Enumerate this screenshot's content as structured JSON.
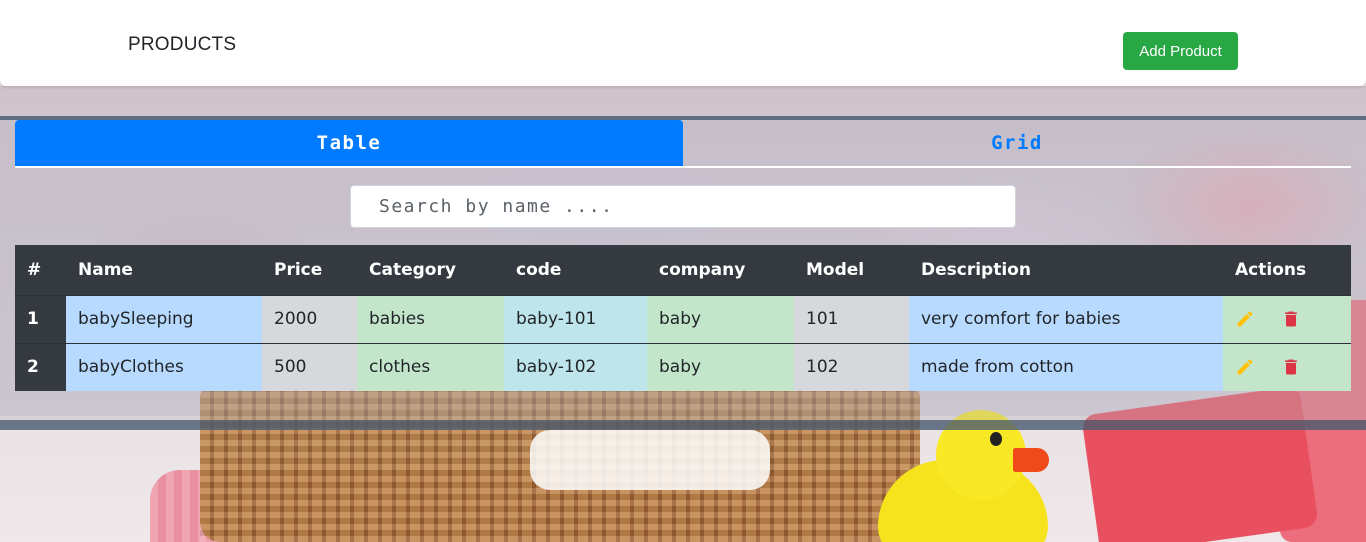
{
  "navbar": {
    "brand": "PRODUCTS",
    "add_button_label": "Add Product",
    "add_button_color": "#28a745"
  },
  "tabs": [
    {
      "label": "Table",
      "active": true
    },
    {
      "label": "Grid",
      "active": false
    }
  ],
  "search": {
    "placeholder": "Search by name ....",
    "value": ""
  },
  "table": {
    "headers": [
      "#",
      "Name",
      "Price",
      "Category",
      "code",
      "company",
      "Model",
      "Description",
      "Actions"
    ],
    "rows": [
      {
        "index": "1",
        "name": "babySleeping",
        "price": "2000",
        "category": "babies",
        "code": "baby-101",
        "company": "baby",
        "model": "101",
        "description": "very comfort for babies"
      },
      {
        "index": "2",
        "name": "babyClothes",
        "price": "500",
        "category": "clothes",
        "code": "baby-102",
        "company": "baby",
        "model": "102",
        "description": "made from cotton"
      }
    ],
    "actions": {
      "edit_icon": "pencil-icon",
      "edit_color": "#ffc107",
      "delete_icon": "trash-icon",
      "delete_color": "#dc3545"
    }
  },
  "colors": {
    "primary": "#007bff",
    "header_dark": "#343a40"
  }
}
